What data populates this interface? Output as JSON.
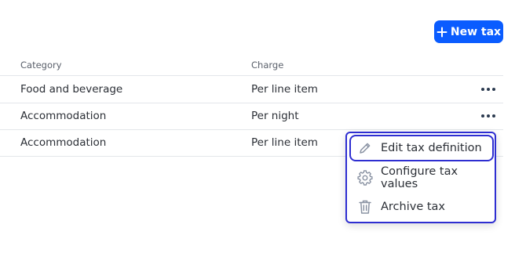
{
  "toolbar": {
    "new_tax_label": "New tax"
  },
  "table": {
    "columns": [
      "Category",
      "Charge"
    ],
    "rows": [
      {
        "category": "Food and beverage",
        "charge": "Per line item"
      },
      {
        "category": "Accommodation",
        "charge": "Per night"
      },
      {
        "category": "Accommodation",
        "charge": "Per line item"
      }
    ]
  },
  "context_menu": {
    "items": [
      {
        "label": "Edit tax definition",
        "icon": "pencil-icon",
        "focused": true
      },
      {
        "label": "Configure tax values",
        "icon": "gear-icon",
        "focused": false
      },
      {
        "label": "Archive tax",
        "icon": "trash-icon",
        "focused": false
      }
    ]
  },
  "colors": {
    "primary": "#0a5cff",
    "focus_ring": "#2e2ed1",
    "divider": "#e3e6ea",
    "icon_muted": "#8a93a3"
  }
}
